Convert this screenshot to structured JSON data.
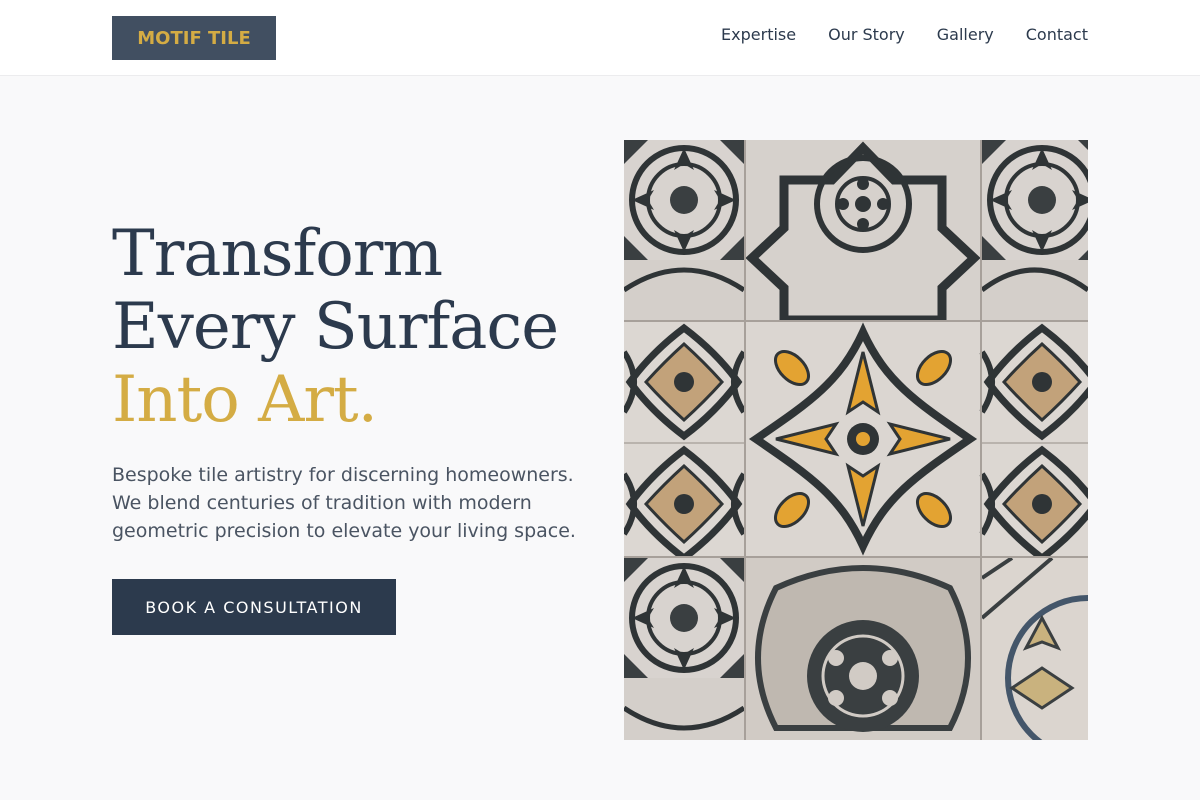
{
  "header": {
    "logo_text": "MOTIF TILE",
    "nav": [
      {
        "label": "Expertise"
      },
      {
        "label": "Our Story"
      },
      {
        "label": "Gallery"
      },
      {
        "label": "Contact"
      }
    ]
  },
  "hero": {
    "headline_line1": "Transform",
    "headline_line2": "Every Surface",
    "headline_accent": "Into Art.",
    "description": "Bespoke tile artistry for discerning homeowners. We blend centuries of tradition with modern geometric precision to elevate your living space.",
    "cta_label": "BOOK A CONSULTATION"
  },
  "colors": {
    "navy": "#2c3a4d",
    "gold": "#d4ac44",
    "logo_bg": "#414f61",
    "background": "#f9f9fa"
  }
}
